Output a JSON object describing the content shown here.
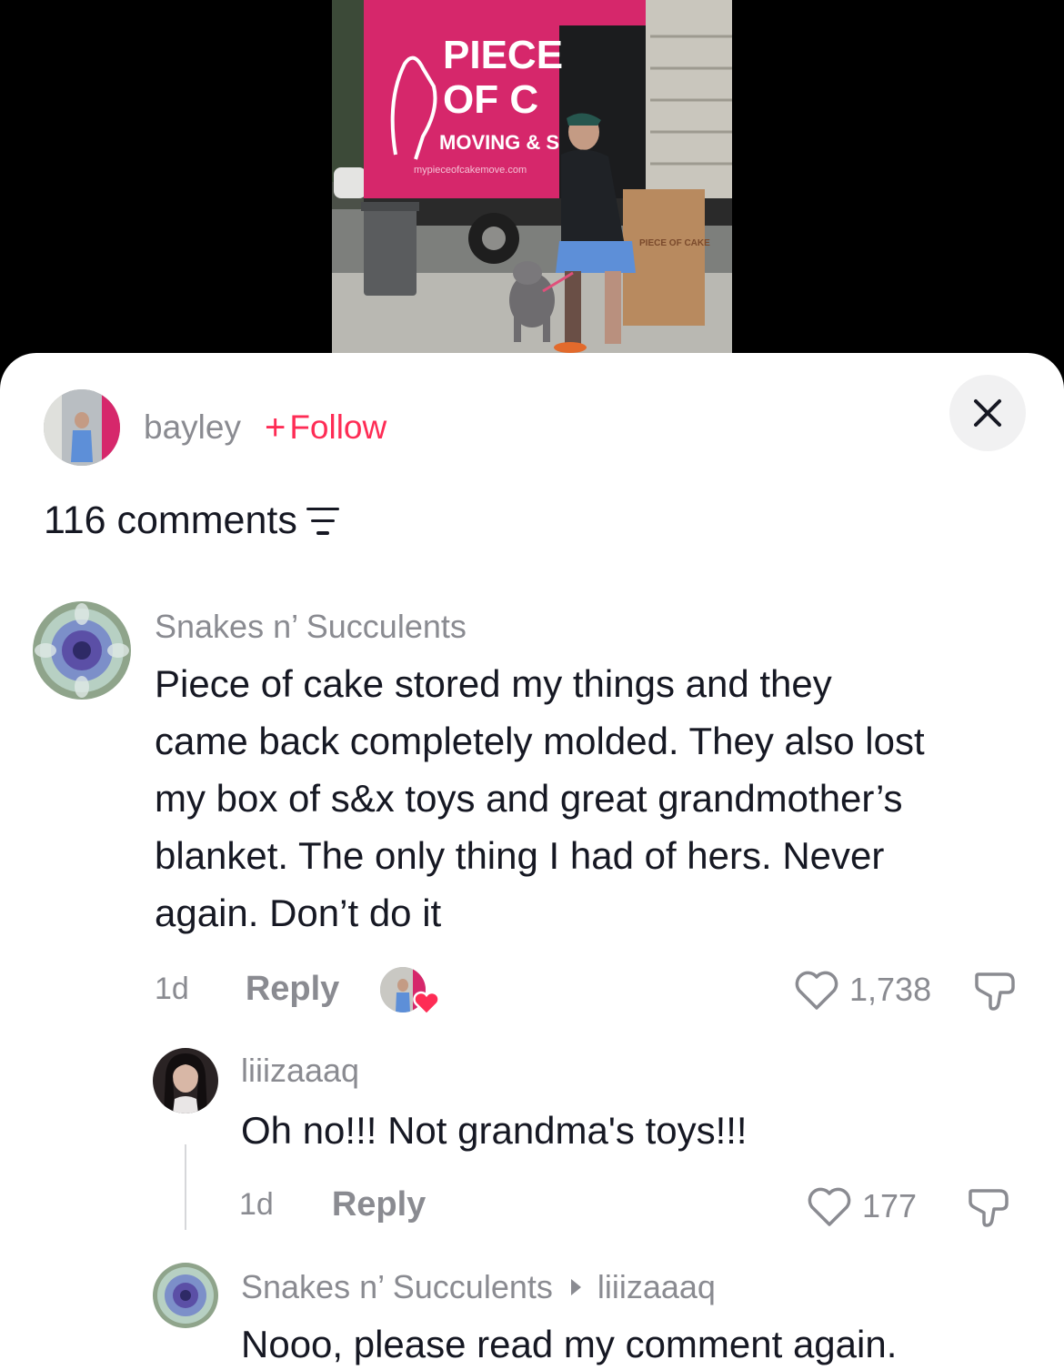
{
  "video": {
    "truck_text_line1": "PIECE",
    "truck_text_line2": "OF C",
    "truck_text_line3": "MOVING & S",
    "truck_url": "mypieceofcakemove.com",
    "box_label": "PIECE OF CAKE"
  },
  "creator": {
    "name": "bayley",
    "follow_label": "Follow"
  },
  "comments_header": {
    "count_label": "116 comments"
  },
  "comments": [
    {
      "author": "Snakes n’ Succulents",
      "text_lines": [
        "Piece of cake stored my things and they",
        "came back completely molded. They also lost",
        "my box of s&x toys and great grandmother’s",
        "blanket. The only thing I had of hers. Never",
        "again. Don’t do it"
      ],
      "time": "1d",
      "reply_label": "Reply",
      "likes": "1,738"
    },
    {
      "author": "liiizaaaq",
      "text": "Oh no!!! Not grandma's toys!!!",
      "time": "1d",
      "reply_label": "Reply",
      "likes": "177"
    },
    {
      "author": "Snakes n’ Succulents",
      "reply_to": "liiizaaaq",
      "text": "Nooo, please read my comment again."
    }
  ],
  "colors": {
    "accent": "#fe2c55",
    "text_primary": "#161823",
    "text_secondary": "#8a8b91",
    "truck": "#d6276b"
  },
  "icons": [
    "close-icon",
    "filter-icon",
    "heart-outline-icon",
    "dislike-icon",
    "heart-filled-icon",
    "reply-arrow-icon"
  ]
}
